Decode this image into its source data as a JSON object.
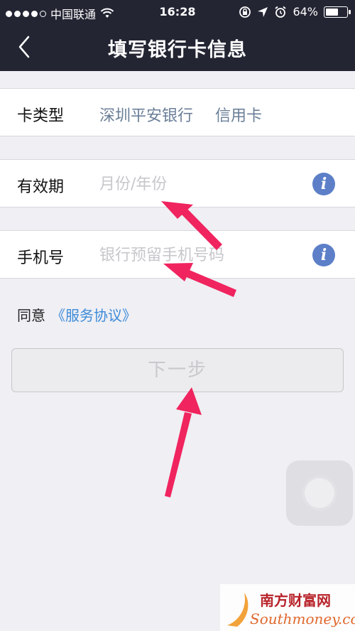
{
  "status_bar": {
    "carrier": "中国联通",
    "time": "16:28",
    "battery": "64%",
    "battery_level": 0.64
  },
  "nav": {
    "title": "填写银行卡信息",
    "back_icon": "chevron-left-icon"
  },
  "form": {
    "card_type": {
      "label": "卡类型",
      "bank": "深圳平安银行",
      "kind": "信用卡"
    },
    "expiry": {
      "label": "有效期",
      "placeholder": "月份/年份",
      "value": ""
    },
    "phone": {
      "label": "手机号",
      "placeholder": "银行预留手机号码",
      "value": ""
    },
    "info_glyph": "i"
  },
  "agreement": {
    "prefix": "同意",
    "link": "《服务协议》"
  },
  "next_button": {
    "label": "下一步"
  },
  "watermark": {
    "text": "南方财富网",
    "domain": "Southmoney.com"
  },
  "colors": {
    "nav_bg": "#232533",
    "accent_link": "#3d8bd8",
    "info_icon": "#5c7fc8",
    "annotation_arrow": "#f0245e"
  }
}
